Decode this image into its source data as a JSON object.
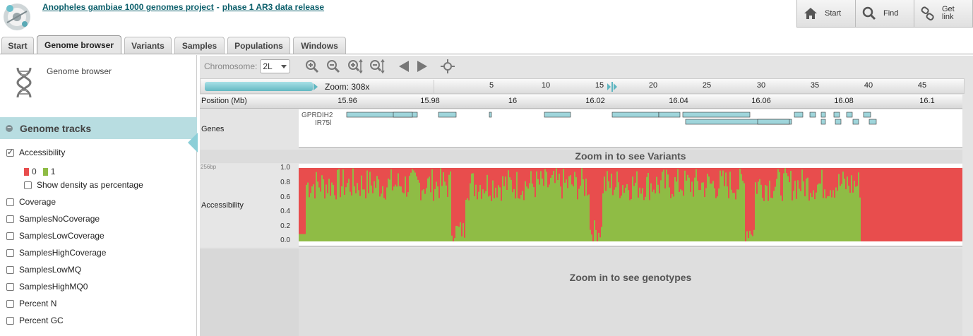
{
  "header": {
    "project_link": "Anopheles gambiae 1000 genomes project",
    "separator": "-",
    "release_link": "phase 1 AR3 data release"
  },
  "top_buttons": [
    {
      "label": "Start",
      "icon": "home-icon"
    },
    {
      "label": "Find",
      "icon": "magnifier-icon"
    },
    {
      "label": "Get link",
      "icon": "chain-link-icon"
    }
  ],
  "tabs": [
    "Start",
    "Genome browser",
    "Variants",
    "Samples",
    "Populations",
    "Windows"
  ],
  "active_tab": "Genome browser",
  "left_panel": {
    "title": "Genome browser",
    "tracks_header": "Genome tracks",
    "tracks": [
      {
        "label": "Accessibility",
        "checked": true
      },
      {
        "label": "Coverage",
        "checked": false
      },
      {
        "label": "SamplesNoCoverage",
        "checked": false
      },
      {
        "label": "SamplesLowCoverage",
        "checked": false
      },
      {
        "label": "SamplesHighCoverage",
        "checked": false
      },
      {
        "label": "SamplesLowMQ",
        "checked": false
      },
      {
        "label": "SamplesHighMQ0",
        "checked": false
      },
      {
        "label": "Percent N",
        "checked": false
      },
      {
        "label": "Percent GC",
        "checked": false
      }
    ],
    "legend": [
      {
        "label": "0",
        "color": "#e84d4d"
      },
      {
        "label": "1",
        "color": "#8fbc45"
      }
    ],
    "density_option": "Show density as percentage"
  },
  "browser": {
    "chromosome_label": "Chromosome:",
    "chromosome_value": "2L",
    "zoom_text": "Zoom: 308x",
    "overview_ticks": [
      "5",
      "10",
      "15",
      "20",
      "25",
      "30",
      "35",
      "40",
      "45"
    ],
    "position_label": "Position (Mb)",
    "position_ticks": [
      "15.96",
      "15.98",
      "16",
      "16.02",
      "16.04",
      "16.06",
      "16.08",
      "16.1"
    ],
    "genes_label": "Genes",
    "gene_names": [
      "GPRDIH2",
      "IR75l"
    ],
    "variants_message": "Zoom in to see Variants",
    "accessibility_label": "Accessibility",
    "bin_size": "256bp",
    "accessibility_yticks": [
      "1.0",
      "0.8",
      "0.6",
      "0.4",
      "0.2",
      "0.0"
    ],
    "genotypes_message": "Zoom in to see genotypes"
  }
}
